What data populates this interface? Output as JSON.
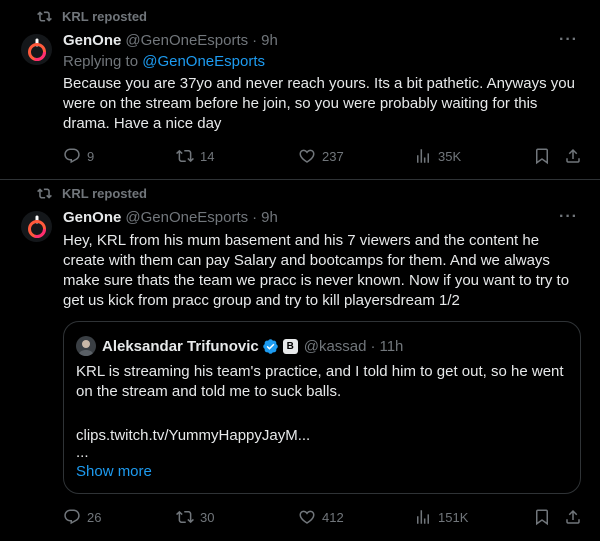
{
  "tweets": [
    {
      "repost_label": "KRL reposted",
      "name": "GenOne",
      "handle": "@GenOneEsports",
      "dot": "·",
      "time": "9h",
      "replying_prefix": "Replying to",
      "replying_to": "@GenOneEsports",
      "text": "Because you are 37yo and never reach yours. Its a bit pathetic. Anyways you were on the stream before he join, so you were probably waiting for this drama. Have a nice day",
      "more": "···",
      "replies": "9",
      "reposts": "14",
      "likes": "237",
      "views": "35K"
    },
    {
      "repost_label": "KRL reposted",
      "name": "GenOne",
      "handle": "@GenOneEsports",
      "dot": "·",
      "time": "9h",
      "text": "Hey, KRL from his mum basement and his 7 viewers and the content he create with them can pay Salary and bootcamps for them. And we always make sure thats the team we pracc is never known. Now if you want to try to get us kick from pracc group and try to kill playersdream 1/2",
      "more": "···",
      "quote": {
        "name": "Aleksandar Trifunovic",
        "handle": "@kassad",
        "dot": "·",
        "time": "11h",
        "text": "KRL is streaming his team's practice, and I told him to get out, so he went on the stream and told me to suck balls.",
        "link": "clips.twitch.tv/YummyHappyJayM...",
        "ellipsis": "...",
        "show_more": "Show more"
      },
      "replies": "26",
      "reposts": "30",
      "likes": "412",
      "views": "151K"
    }
  ],
  "colors": {
    "background": "#000000",
    "text": "#e7e9ea",
    "muted": "#71767b",
    "link": "#1d9bf0",
    "border": "#2f3336"
  }
}
